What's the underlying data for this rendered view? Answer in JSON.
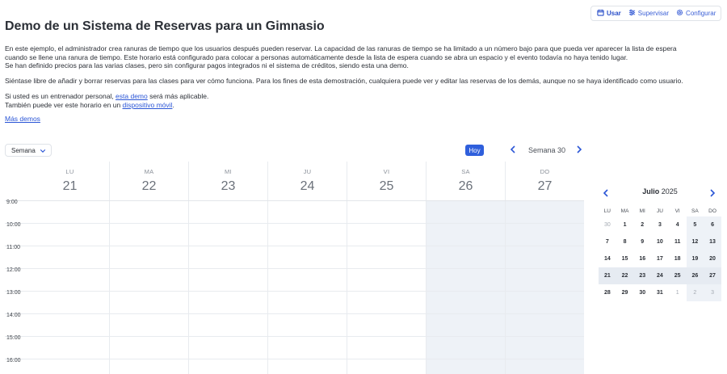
{
  "nav": {
    "tabs": [
      {
        "label": "Usar",
        "icon": "calendar-icon",
        "active": true
      },
      {
        "label": "Supervisar",
        "icon": "sliders-icon",
        "active": false
      },
      {
        "label": "Configurar",
        "icon": "gear-icon",
        "active": false
      }
    ]
  },
  "page": {
    "title": "Demo de un Sistema de Reservas para un Gimnasio",
    "intro_p1_l1": "En este ejemplo, el administrador crea ranuras de tiempo que los usuarios después pueden reservar. La capacidad de las ranuras de tiempo se ha limitado a un número bajo para que pueda ver aparecer la lista de espera",
    "intro_p1_l2": "cuando se llene una ranura de tiempo. Este horario está configurado para colocar a personas automáticamente desde la lista de espera cuando se abra un espacio y el evento todavía no haya tenido lugar.",
    "intro_p1_l3": "Se han definido precios para las varias clases, pero sin configurar pagos integrados ni el sistema de créditos, siendo esta una demo.",
    "intro_p2": "Siéntase libre de añadir y borrar reservas para las clases para ver cómo funciona. Para los fines de esta demostración, cualquiera puede ver y editar las reservas de los demás, aunque no se haya identificado como usuario.",
    "intro_p3_a": "Si usted es un entrenador personal, ",
    "intro_p3_link": "esta demo",
    "intro_p3_b": " será más aplicable.",
    "intro_p4_a": "También puede ver este horario en un ",
    "intro_p4_link": "dispositivo móvil",
    "intro_p4_b": ".",
    "more_demos": "Más demos"
  },
  "toolbar": {
    "view_select": "Semana",
    "today_label": "Hoy",
    "week_label": "Semana 30"
  },
  "calendar": {
    "days": [
      {
        "name": "LU",
        "date": "21",
        "weekend": false
      },
      {
        "name": "MA",
        "date": "22",
        "weekend": false
      },
      {
        "name": "MI",
        "date": "23",
        "weekend": false
      },
      {
        "name": "JU",
        "date": "24",
        "weekend": false
      },
      {
        "name": "VI",
        "date": "25",
        "weekend": false
      },
      {
        "name": "SA",
        "date": "26",
        "weekend": true
      },
      {
        "name": "DO",
        "date": "27",
        "weekend": true
      }
    ],
    "hours": [
      "9:00",
      "10:00",
      "11:00",
      "12:00",
      "13:00",
      "14:00",
      "15:00",
      "16:00"
    ]
  },
  "mini_calendar": {
    "month": "Julio",
    "year": "2025",
    "weekdays": [
      "LU",
      "MA",
      "MI",
      "JU",
      "VI",
      "SA",
      "DO"
    ],
    "selected_week": 3,
    "weeks": [
      [
        "30",
        "1",
        "2",
        "3",
        "4",
        "5",
        "6"
      ],
      [
        "7",
        "8",
        "9",
        "10",
        "11",
        "12",
        "13"
      ],
      [
        "14",
        "15",
        "16",
        "17",
        "18",
        "19",
        "20"
      ],
      [
        "21",
        "22",
        "23",
        "24",
        "25",
        "26",
        "27"
      ],
      [
        "28",
        "29",
        "30",
        "31",
        "1",
        "2",
        "3"
      ]
    ],
    "outside": [
      [
        0,
        0
      ],
      [
        4,
        4
      ],
      [
        4,
        5
      ],
      [
        4,
        6
      ]
    ]
  }
}
